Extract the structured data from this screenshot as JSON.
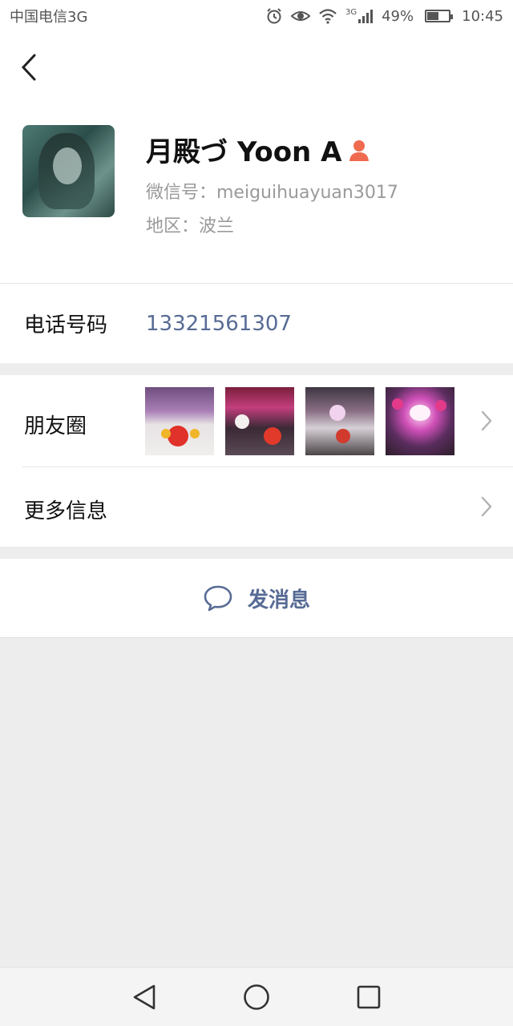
{
  "status_bar": {
    "carrier": "中国电信3G",
    "network_label": "3G",
    "battery_percent": "49%",
    "battery_level": 0.49,
    "time": "10:45",
    "icons": [
      "alarm-icon",
      "eye-icon",
      "wifi-icon",
      "signal-icon",
      "battery-icon"
    ]
  },
  "header": {
    "back_icon": "chevron-left-icon"
  },
  "profile": {
    "name": "月殿づ Yoon A",
    "gender_icon": "female-user-icon",
    "gender_color": "#f06a50",
    "wechat_id": "微信号：meiguihuayuan3017",
    "region": "地区：波兰"
  },
  "phone": {
    "label": "电话号码",
    "number": "13321561307",
    "number_color": "#576b95"
  },
  "moments": {
    "label": "朋友圈",
    "thumbnails": [
      "moment-photo-1",
      "moment-photo-2",
      "moment-photo-3",
      "moment-photo-4"
    ]
  },
  "more_info": {
    "label": "更多信息"
  },
  "send_message": {
    "label": "发消息",
    "icon": "chat-bubble-icon",
    "color": "#576b95"
  },
  "nav_bar": {
    "buttons": [
      "back-triangle-icon",
      "home-circle-icon",
      "recents-square-icon"
    ]
  }
}
